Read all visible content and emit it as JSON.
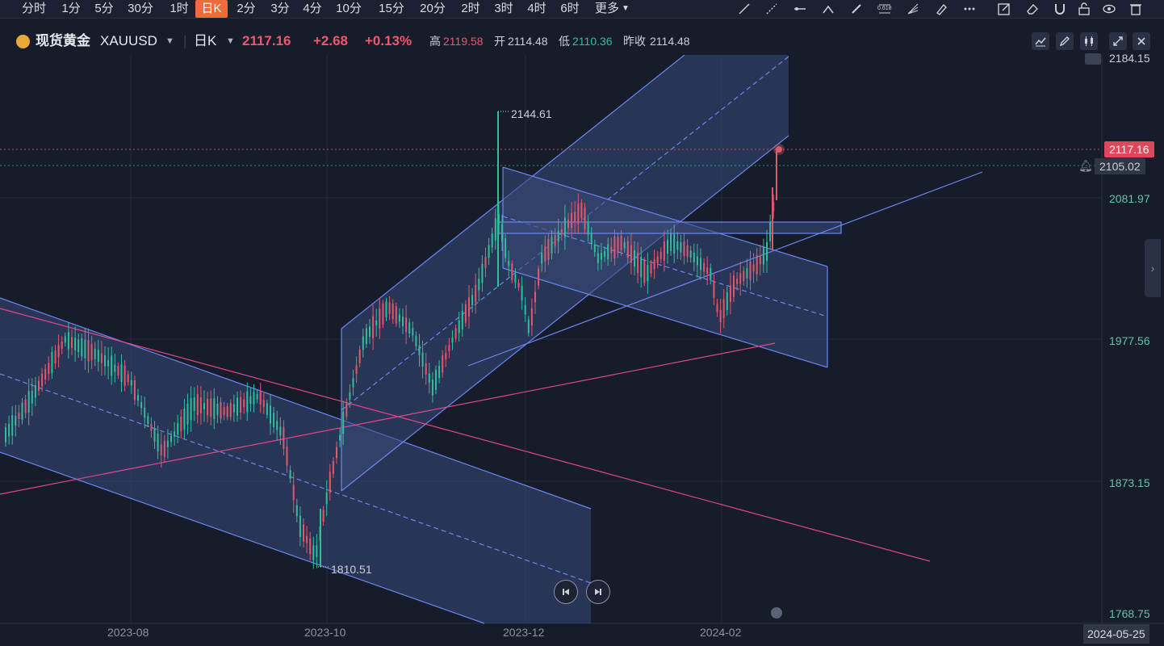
{
  "toolbar": {
    "periods": [
      "分时",
      "1分",
      "5分",
      "30分",
      "1时",
      "日K",
      "2分",
      "3分",
      "4分",
      "10分",
      "15分",
      "20分",
      "2时",
      "3时",
      "4时",
      "6时",
      "更多"
    ],
    "active_index": 5,
    "tools": [
      "trendline-icon",
      "ray-icon",
      "horizontal-line-icon",
      "segment-icon",
      "pen-icon",
      "fib-icon",
      "fan-icon",
      "highlighter-icon",
      "more-dots-icon",
      "edit-icon",
      "eraser-icon",
      "magnet-icon",
      "lock-icon",
      "eye-icon",
      "trash-icon"
    ],
    "fib_label": "0.618"
  },
  "header": {
    "symbol_name": "现货黄金",
    "symbol_code": "XAUUSD",
    "interval": "日K",
    "price": "2117.16",
    "change": "+2.68",
    "change_pct": "+0.13%",
    "high_label": "高",
    "high": "2119.58",
    "open_label": "开",
    "open": "2114.48",
    "low_label": "低",
    "low": "2110.36",
    "prev_label": "昨收",
    "prev": "2114.48"
  },
  "right_buttons": [
    "chart-type-icon",
    "draw-icon",
    "candle-settings-icon",
    "fullscreen-icon",
    "close-icon"
  ],
  "axis": {
    "price_labels": [
      "2184.15",
      "2081.97",
      "1977.56",
      "1873.15",
      "1768.75"
    ],
    "current_price_tag": "2117.16",
    "alert_price_tag": "2105.02",
    "dates": [
      "2023-08",
      "2023-10",
      "2023-12",
      "2024-02"
    ],
    "crosshair_date": "2024-05-25"
  },
  "annotations": {
    "high_marker": "2144.61",
    "low_marker": "1810.51"
  },
  "colors": {
    "up": "#e0586b",
    "down": "#2fbf9a",
    "channel_fill": "#3b4a7a",
    "channel_line": "#6b86f0",
    "pink_line": "#e0478a",
    "accent": "#f06a3a"
  },
  "chart_data": {
    "type": "candlestick",
    "symbol": "XAUUSD",
    "interval": "daily",
    "last": 2117.16,
    "high": 2119.58,
    "open": 2114.48,
    "low": 2110.36,
    "prev_close": 2114.48,
    "alert_level": 2105.02,
    "marked_high": 2144.61,
    "marked_low": 1810.51,
    "y_ticks": [
      2184.15,
      2081.97,
      1977.56,
      1873.15,
      1768.75
    ],
    "x_ticks": [
      "2023-08",
      "2023-10",
      "2023-12",
      "2024-02"
    ]
  }
}
